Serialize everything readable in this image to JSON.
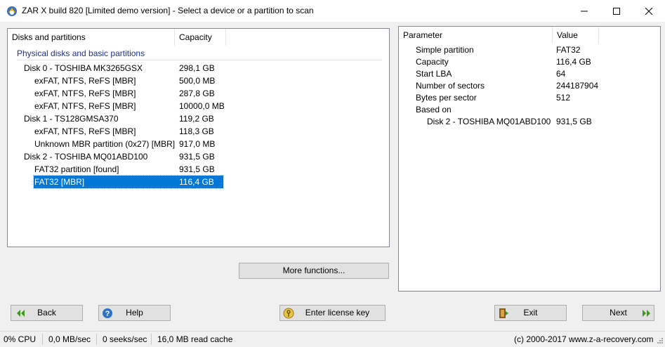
{
  "window": {
    "title": "ZAR X build 820 [Limited demo version] - Select a device or a partition to scan"
  },
  "left_panel": {
    "columns": [
      "Disks and partitions",
      "Capacity"
    ],
    "group_title": "Physical disks and basic partitions",
    "rows": [
      {
        "name": "Disk 0 - TOSHIBA MK3265GSX",
        "capacity": "298,1 GB",
        "level": 1
      },
      {
        "name": "exFAT, NTFS, ReFS [MBR]",
        "capacity": "500,0 MB",
        "level": 2
      },
      {
        "name": "exFAT, NTFS, ReFS [MBR]",
        "capacity": "287,8 GB",
        "level": 2
      },
      {
        "name": "exFAT, NTFS, ReFS [MBR]",
        "capacity": "10000,0 MB",
        "level": 2
      },
      {
        "name": "Disk 1 - TS128GMSA370",
        "capacity": "119,2 GB",
        "level": 1
      },
      {
        "name": "exFAT, NTFS, ReFS [MBR]",
        "capacity": "118,3 GB",
        "level": 2
      },
      {
        "name": "Unknown MBR partition (0x27) [MBR]",
        "capacity": "917,0 MB",
        "level": 2
      },
      {
        "name": "Disk 2 - TOSHIBA MQ01ABD100",
        "capacity": "931,5 GB",
        "level": 1
      },
      {
        "name": "FAT32 partition [found]",
        "capacity": "931,5 GB",
        "level": 2
      },
      {
        "name": "FAT32 [MBR]",
        "capacity": "116,4 GB",
        "level": 2,
        "selected": true
      }
    ],
    "more_functions_label": "More functions..."
  },
  "right_panel": {
    "columns": [
      "Parameter",
      "Value"
    ],
    "rows": [
      {
        "param": "Simple partition",
        "value": "FAT32",
        "level": 1
      },
      {
        "param": "Capacity",
        "value": "116,4 GB",
        "level": 1
      },
      {
        "param": "Start LBA",
        "value": "64",
        "level": 1
      },
      {
        "param": "Number of sectors",
        "value": "244187904",
        "level": 1
      },
      {
        "param": "Bytes per sector",
        "value": "512",
        "level": 1
      },
      {
        "param": "Based on",
        "value": "",
        "level": 1
      },
      {
        "param": "Disk 2 - TOSHIBA MQ01ABD100",
        "value": "931,5 GB",
        "level": 2
      }
    ]
  },
  "buttons": {
    "back": "Back",
    "help": "Help",
    "license": "Enter license key",
    "exit": "Exit",
    "next": "Next"
  },
  "status": {
    "cpu": "0% CPU",
    "speed": "0,0 MB/sec",
    "seeks": "0 seeks/sec",
    "cache": "16,0 MB read cache",
    "copyright": "(c) 2000-2017 www.z-a-recovery.com"
  },
  "colors": {
    "selection": "#0078d7",
    "group_title": "#1e3287",
    "arrow_green": "#3a9a1c"
  }
}
